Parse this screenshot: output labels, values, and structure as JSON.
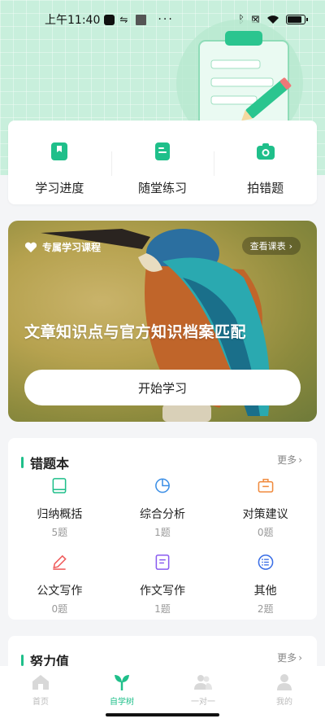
{
  "status_bar": {
    "time": "上午11:40",
    "dots": "···",
    "battery_level": 0.85
  },
  "quick_actions": [
    {
      "label": "学习进度",
      "icon": "bookmark-book-icon"
    },
    {
      "label": "随堂练习",
      "icon": "document-icon"
    },
    {
      "label": "拍错题",
      "icon": "camera-icon"
    }
  ],
  "banner": {
    "tag": "专属学习课程",
    "view_button": "查看课表",
    "title": "文章知识点与官方知识档案匹配",
    "start_button": "开始学习"
  },
  "errors_section": {
    "title": "错题本",
    "more": "更多",
    "items": [
      {
        "name": "归纳概括",
        "count": "5题",
        "icon": "book-icon",
        "color": "#1fbf8a"
      },
      {
        "name": "综合分析",
        "count": "1题",
        "icon": "pie-chart-icon",
        "color": "#3a8ee6"
      },
      {
        "name": "对策建议",
        "count": "0题",
        "icon": "briefcase-icon",
        "color": "#f08a3c"
      },
      {
        "name": "公文写作",
        "count": "0题",
        "icon": "pencil-icon",
        "color": "#ef5a5a"
      },
      {
        "name": "作文写作",
        "count": "1题",
        "icon": "note-icon",
        "color": "#8a5cf0"
      },
      {
        "name": "其他",
        "count": "2题",
        "icon": "list-icon",
        "color": "#3a6ee6"
      }
    ]
  },
  "effort_section": {
    "title": "努力值",
    "more": "更多"
  },
  "tabbar": [
    {
      "label": "首页",
      "icon": "home-icon",
      "active": false
    },
    {
      "label": "自学树",
      "icon": "sprout-icon",
      "active": true
    },
    {
      "label": "一对一",
      "icon": "people-icon",
      "active": false
    },
    {
      "label": "我的",
      "icon": "person-icon",
      "active": false
    }
  ],
  "colors": {
    "accent": "#1fbf8a",
    "hero_bg": "#c8efdc"
  }
}
